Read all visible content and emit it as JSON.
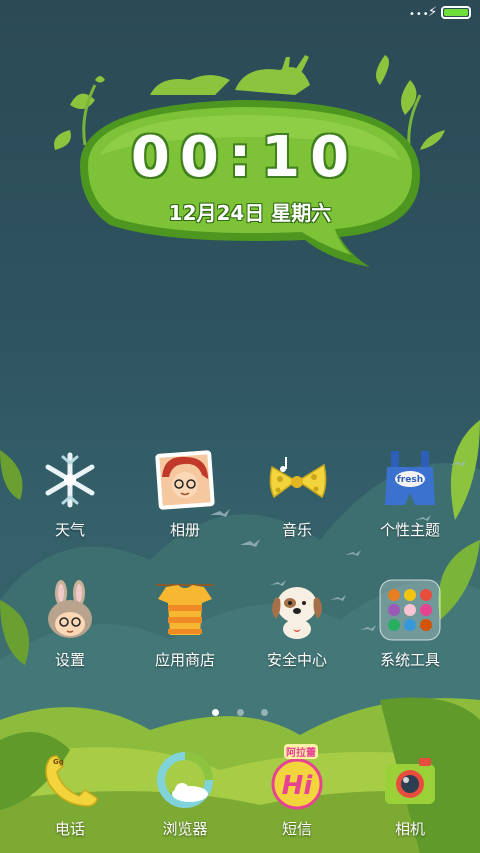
{
  "status_bar": {
    "signal_dots": "•••",
    "charging_icon": "charging-bolt-icon",
    "battery_level": 1.0,
    "battery_color": "#6ede3a"
  },
  "clock": {
    "time": "00:10",
    "date": "12月24日 星期六"
  },
  "apps": [
    {
      "label": "天气",
      "icon": "snowflake-icon"
    },
    {
      "label": "相册",
      "icon": "girl-portrait-icon"
    },
    {
      "label": "音乐",
      "icon": "cheese-bow-icon"
    },
    {
      "label": "个性主题",
      "icon": "fresh-overalls-icon"
    },
    {
      "label": "设置",
      "icon": "bunny-girl-icon"
    },
    {
      "label": "应用商店",
      "icon": "tshirt-icon"
    },
    {
      "label": "安全中心",
      "icon": "puppy-icon"
    },
    {
      "label": "系统工具",
      "icon": "tools-folder-icon"
    }
  ],
  "page_indicator": {
    "pages": 3,
    "active": 0
  },
  "dock": [
    {
      "label": "电话",
      "icon": "phone-handset-icon"
    },
    {
      "label": "浏览器",
      "icon": "browser-globe-icon"
    },
    {
      "label": "短信",
      "icon": "hi-bubble-icon",
      "badge_text": "阿拉蕾"
    },
    {
      "label": "相机",
      "icon": "camera-icon"
    }
  ]
}
